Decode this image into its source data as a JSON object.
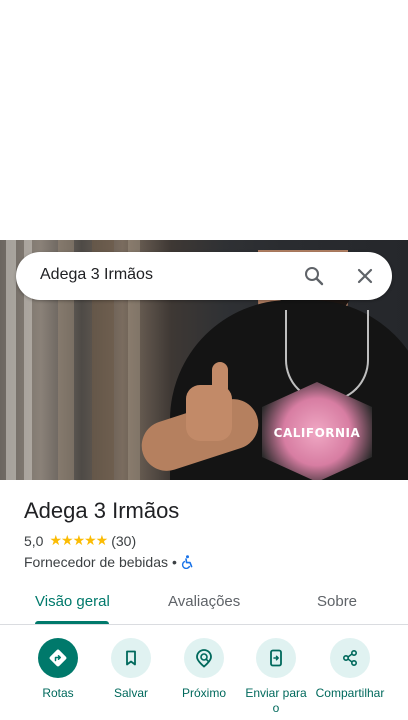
{
  "search": {
    "query": "Adega 3 Irmãos",
    "search_icon": "search-icon",
    "close_icon": "close-icon"
  },
  "hero": {
    "shirt_text": "CALIFORNIA"
  },
  "place": {
    "name": "Adega 3 Irmãos",
    "rating": "5,0",
    "stars": "★★★★★",
    "review_count": "(30)",
    "category": "Fornecedor de bebidas",
    "separator": "•",
    "accessibility_icon": "wheelchair-icon"
  },
  "tabs": [
    {
      "label": "Visão geral",
      "active": true
    },
    {
      "label": "Avaliações",
      "active": false
    },
    {
      "label": "Sobre",
      "active": false
    }
  ],
  "actions": [
    {
      "label": "Rotas",
      "icon": "directions-icon"
    },
    {
      "label": "Salvar",
      "icon": "bookmark-icon"
    },
    {
      "label": "Próximo",
      "icon": "nearby-icon"
    },
    {
      "label": "Enviar para o",
      "icon": "send-to-phone-icon"
    },
    {
      "label": "Compartilhar",
      "icon": "share-icon"
    }
  ],
  "colors": {
    "accent": "#00796b",
    "action_bg": "#e0f2f1",
    "star": "#fbbc04",
    "accessibility": "#1a73e8"
  }
}
